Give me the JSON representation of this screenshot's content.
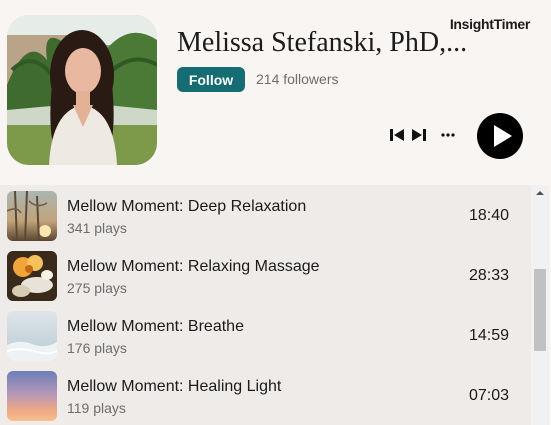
{
  "brand": {
    "name": "InsightTimer"
  },
  "teacher": {
    "name": "Melissa Stefanski, PhD,...",
    "follow_label": "Follow",
    "followers_text": "214 followers"
  },
  "controls": {
    "prev_icon": "skip-previous-icon",
    "next_icon": "skip-next-icon",
    "more_icon": "more-horizontal-icon",
    "play_icon": "play-icon"
  },
  "tracks": [
    {
      "title": "Mellow Moment: Deep Relaxation",
      "plays": "341 plays",
      "duration": "18:40"
    },
    {
      "title": "Mellow Moment: Relaxing Massage",
      "plays": "275 plays",
      "duration": "28:33"
    },
    {
      "title": "Mellow Moment: Breathe",
      "plays": "176 plays",
      "duration": "14:59"
    },
    {
      "title": "Mellow Moment: Healing Light",
      "plays": "119 plays",
      "duration": "07:03"
    }
  ],
  "colors": {
    "follow_button": "#156d73",
    "header_bg": "#f9f5f3",
    "list_bg": "#eeebe9",
    "text_primary": "#1b1b1b",
    "text_secondary": "#6d6d6d"
  }
}
